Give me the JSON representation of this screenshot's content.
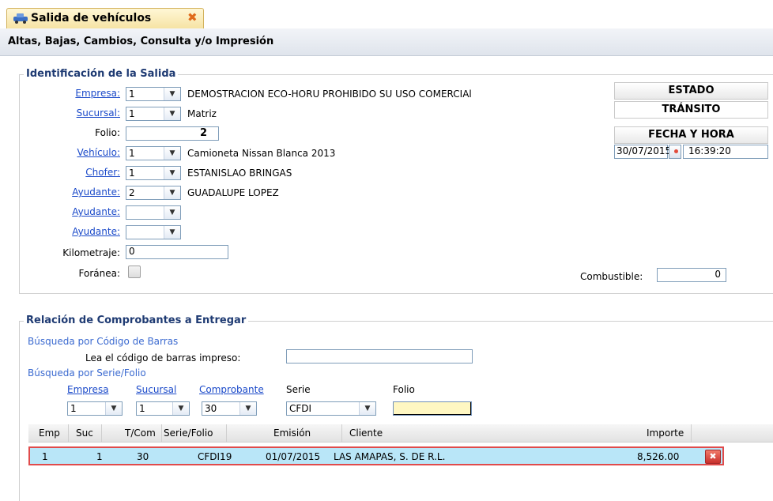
{
  "tab": {
    "title": "Salida de vehículos",
    "close": "✖",
    "icon": "car-icon"
  },
  "subbar": {
    "title": "Altas, Bajas, Cambios, Consulta y/o Impresión"
  },
  "identificacion": {
    "legend": "Identificación de la Salida",
    "empresa": {
      "label": "Empresa:",
      "value": "1",
      "desc": "DEMOSTRACION ECO-HORU PROHIBIDO SU USO COMERCIAl"
    },
    "sucursal": {
      "label": "Sucursal:",
      "value": "1",
      "desc": "Matriz"
    },
    "folio": {
      "label": "Folio:",
      "value": "2"
    },
    "vehiculo": {
      "label": "Vehículo:",
      "value": "1",
      "desc": "Camioneta Nissan Blanca 2013"
    },
    "chofer": {
      "label": "Chofer:",
      "value": "1",
      "desc": "ESTANISLAO BRINGAS"
    },
    "ayudante1": {
      "label": "Ayudante:",
      "value": "2",
      "desc": "GUADALUPE LOPEZ"
    },
    "ayudante2": {
      "label": "Ayudante:",
      "value": ""
    },
    "ayudante3": {
      "label": "Ayudante:",
      "value": ""
    },
    "kilometraje": {
      "label": "Kilometraje:",
      "value": "0"
    },
    "foranea": {
      "label": "Foránea:"
    },
    "combustible": {
      "label": "Combustible:",
      "value": "0"
    },
    "estado": {
      "header": "ESTADO",
      "value": "TRÁNSITO"
    },
    "fecha": {
      "header": "FECHA Y HORA",
      "date": "30/07/2015",
      "time": "16:39:20"
    }
  },
  "relacion": {
    "legend": "Relación de Comprobantes a Entregar",
    "barcode_title": "Búsqueda por Código de Barras",
    "barcode_label": "Lea el código de barras impreso:",
    "barcode_value": "",
    "serie_title": "Búsqueda por Serie/Folio",
    "filters": {
      "empresa": {
        "label": "Empresa",
        "value": "1"
      },
      "sucursal": {
        "label": "Sucursal",
        "value": "1"
      },
      "comprobante": {
        "label": "Comprobante",
        "value": "30"
      },
      "serie": {
        "label": "Serie",
        "value": "CFDI"
      },
      "folio": {
        "label": "Folio",
        "value": ""
      }
    }
  },
  "grid": {
    "headers": {
      "emp": "Emp",
      "suc": "Suc",
      "tcom": "T/Com",
      "serie": "Serie/Folio",
      "emision": "Emisión",
      "cliente": "Cliente",
      "importe": "Importe"
    },
    "rows": [
      {
        "emp": "1",
        "suc": "1",
        "tcom": "30",
        "serie": "CFDI19",
        "emision": "01/07/2015",
        "cliente": "LAS AMAPAS, S. DE R.L.",
        "importe": "8,526.00"
      }
    ],
    "delete_glyph": "✖"
  }
}
